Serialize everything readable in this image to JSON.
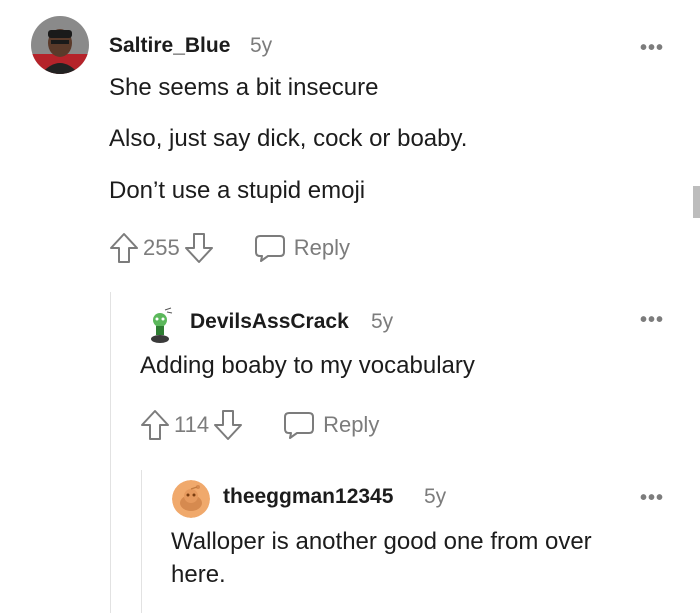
{
  "comments": [
    {
      "username": "Saltire_Blue",
      "age": "5y",
      "lines": [
        "She seems a bit insecure",
        "Also, just say dick, cock or boaby.",
        "Don’t use a stupid emoji"
      ],
      "votes": "255",
      "reply_label": "Reply",
      "more_label": "•••"
    },
    {
      "username": "DevilsAssCrack",
      "age": "5y",
      "lines": [
        "Adding boaby to my vocabulary"
      ],
      "votes": "114",
      "reply_label": "Reply",
      "more_label": "•••"
    },
    {
      "username": "theeggman12345",
      "age": "5y",
      "lines": [
        "Walloper is another good one from over",
        "here."
      ],
      "more_label": "•••"
    }
  ],
  "colors": {
    "meta": "#7c7c7c",
    "text": "#1c1c1c",
    "thread_line": "#e2e2e2",
    "egg_avatar_bg": "#f0a96c"
  },
  "icons": [
    "upvote-icon",
    "downvote-icon",
    "comment-bubble-icon",
    "more-options-icon"
  ]
}
